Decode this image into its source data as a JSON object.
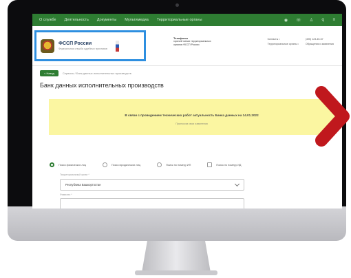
{
  "topnav": {
    "items": [
      "О службе",
      "Деятельность",
      "Документы",
      "Мультимедиа",
      "Территориальные органы"
    ],
    "icons": [
      "eye-icon",
      "phone-icon",
      "user-icon",
      "search-icon",
      "menu-icon"
    ]
  },
  "header": {
    "logo_title": "ФССП России",
    "logo_sub": "Федеральная служба судебных приставов",
    "phone_title": "Телефоны",
    "phone_lines": [
      "горячей линии территориальных",
      "органов ФССП России"
    ],
    "contacts": [
      "Контакты •",
      "(495) 123-45-67",
      "Территориальные органы •",
      "Обращения и заявления"
    ]
  },
  "breadcrumb": {
    "back_label": "< Назад",
    "path": "Сервисы  /  Банк данных исполнительных производств"
  },
  "page_title": "Банк данных исполнительных производств",
  "notice": {
    "main": "В связи с проведением технических работ актуальность Банка данных на 14.01.2022",
    "sub": "Приносим свои извинения"
  },
  "search_types": [
    {
      "label": "Поиск физических лиц",
      "checked": true
    },
    {
      "label": "Поиск юридических лиц",
      "checked": false
    },
    {
      "label": "Поиск по номеру ИП",
      "checked": false
    },
    {
      "label": "Поиск по номеру ИД",
      "checked": false
    }
  ],
  "form": {
    "region_label": "Территориальный орган *",
    "region_value": "Республика Башкортостан",
    "next_label": "Фамилия *"
  },
  "colors": {
    "brand_green": "#2e7d32",
    "highlight_blue": "#2e8fe0",
    "notice_yellow": "#fbf6a1",
    "arrow_red": "#c0181d"
  }
}
